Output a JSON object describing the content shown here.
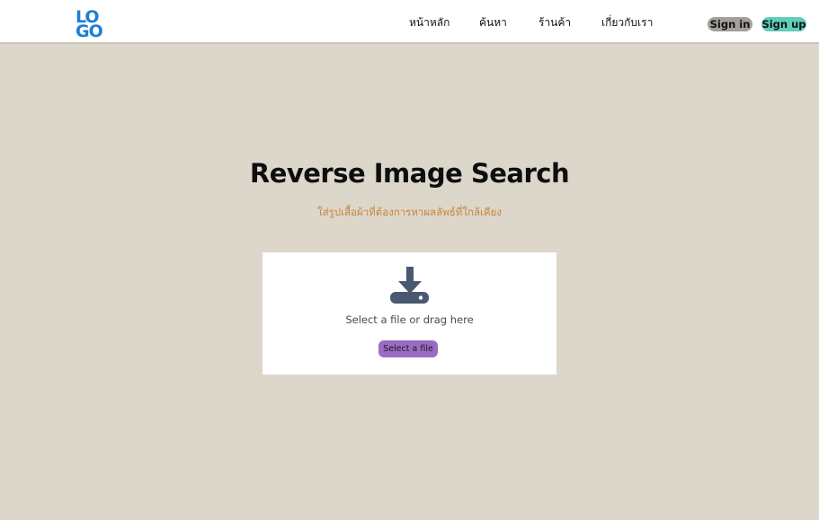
{
  "header": {
    "logo_line1": "LO",
    "logo_line2": "GO",
    "nav": [
      "หน้าหลัก",
      "ค้นหา",
      "ร้านค้า",
      "เกี่ยวกับเรา"
    ],
    "signin_label": "Sign in",
    "signup_label": "Sign up"
  },
  "main": {
    "title": "Reverse Image Search",
    "subtitle": "ใส่รูปเสื้อผ้าที่ต้องการหาผลลัพธ์ที่ใกล้เคียง",
    "upload_hint": "Select a file or drag here",
    "select_button_label": "Select a file",
    "upload_icon": "download-icon"
  },
  "colors": {
    "background": "#dcd7ca",
    "logo": "#1b7fd6",
    "signin": "#a3a09a",
    "signup": "#5fcfb8",
    "subtitle": "#c9843f",
    "select_button": "#9b6cc4",
    "icon": "#4b5872"
  }
}
